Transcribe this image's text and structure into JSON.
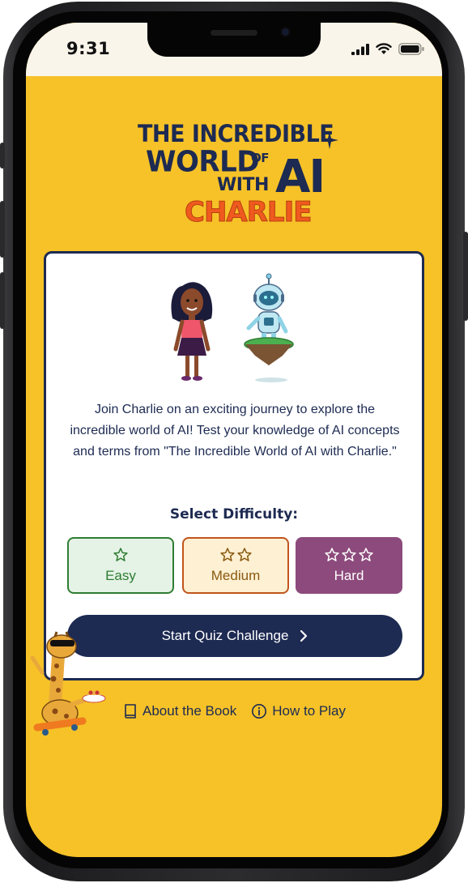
{
  "status": {
    "time": "9:31"
  },
  "hero": {
    "title_line1": "THE INCREDIBLE",
    "title_line2": "WORLD",
    "title_of": "OF",
    "title_with": "WITH",
    "title_ai": "AI",
    "title_name": "CHARLIE"
  },
  "card": {
    "intro": "Join Charlie on an exciting journey to explore the incredible world of AI! Test your knowledge of AI concepts and terms from \"The Incredible World of AI with Charlie.\"",
    "difficulty_label": "Select Difficulty:",
    "difficulties": [
      {
        "label": "Easy",
        "stars": 1
      },
      {
        "label": "Medium",
        "stars": 2
      },
      {
        "label": "Hard",
        "stars": 3
      }
    ],
    "start_label": "Start Quiz Challenge"
  },
  "footer": {
    "about_label": "About the Book",
    "howto_label": "How to Play"
  },
  "colors": {
    "background": "#f6c228",
    "navy": "#1d2a52",
    "accent_orange": "#ef5a1f",
    "easy_green": "#2e7d32",
    "medium_orange": "#c0551c",
    "hard_purple": "#8d4a7c"
  },
  "icons": {
    "signal": "cellular-signal-icon",
    "wifi": "wifi-icon",
    "battery": "battery-icon",
    "star": "star-outline-icon",
    "chevron": "chevron-right-icon",
    "book": "book-icon",
    "info": "info-circle-icon"
  }
}
